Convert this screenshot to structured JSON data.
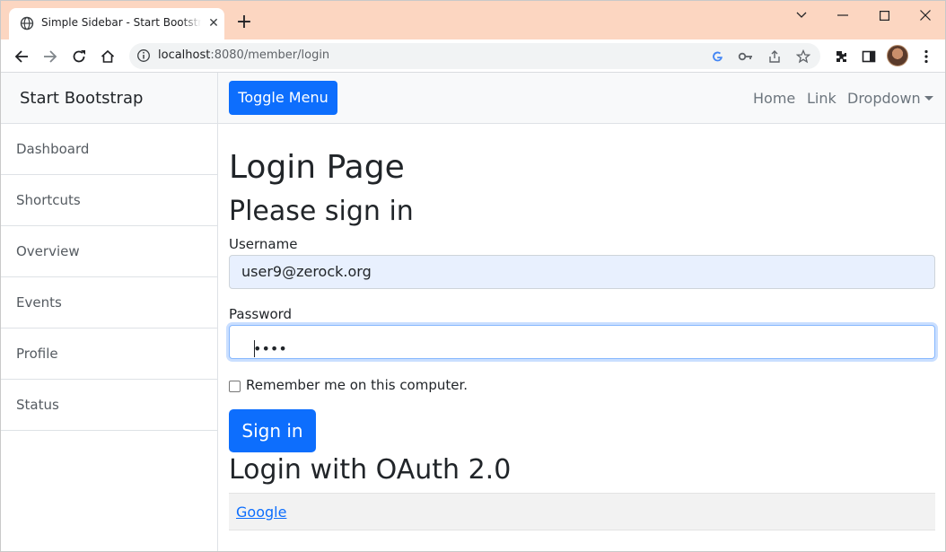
{
  "browser": {
    "tab_title": "Simple Sidebar - Start Bootstrap Template",
    "tab_close": "✕",
    "new_tab": "+",
    "url_host": "localhost",
    "url_rest": ":8080/member/login",
    "colors": {
      "tabstrip": "#fcd6c1",
      "omnibox": "#f1f3f4"
    }
  },
  "sidebar": {
    "brand": "Start Bootstrap",
    "items": [
      {
        "label": "Dashboard"
      },
      {
        "label": "Shortcuts"
      },
      {
        "label": "Overview"
      },
      {
        "label": "Events"
      },
      {
        "label": "Profile"
      },
      {
        "label": "Status"
      }
    ]
  },
  "navbar": {
    "toggle_label": "Toggle Menu",
    "links": [
      {
        "label": "Home"
      },
      {
        "label": "Link"
      },
      {
        "label": "Dropdown"
      }
    ]
  },
  "main": {
    "title": "Login Page",
    "subtitle": "Please sign in",
    "username_label": "Username",
    "username_value": "user9@zerock.org",
    "password_label": "Password",
    "password_value": "••••",
    "remember_label": "Remember me on this computer.",
    "remember_checked": false,
    "signin_label": "Sign in",
    "oauth_title": "Login with OAuth 2.0",
    "oauth_links": [
      {
        "label": "Google"
      }
    ],
    "colors": {
      "primary": "#0d6efd",
      "autofill": "#e8f0fe",
      "focus": "#86b7fe"
    }
  }
}
